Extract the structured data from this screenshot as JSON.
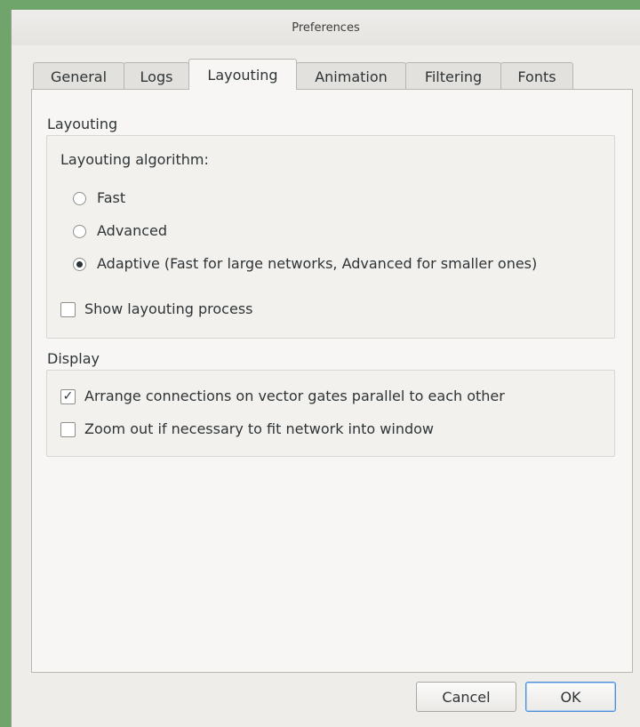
{
  "window": {
    "title": "Preferences"
  },
  "tabs": [
    {
      "label": "General"
    },
    {
      "label": "Logs"
    },
    {
      "label": "Layouting",
      "active": true
    },
    {
      "label": "Animation"
    },
    {
      "label": "Filtering"
    },
    {
      "label": "Fonts"
    }
  ],
  "layouting": {
    "section_title": "Layouting",
    "algorithm_label": "Layouting algorithm:",
    "options": [
      {
        "label": "Fast",
        "checked": false
      },
      {
        "label": "Advanced",
        "checked": false
      },
      {
        "label": "Adaptive (Fast for large networks, Advanced for smaller ones)",
        "checked": true
      }
    ],
    "show_process": {
      "label": "Show layouting process",
      "checked": false
    }
  },
  "display": {
    "section_title": "Display",
    "arrange_connections": {
      "label": "Arrange connections on vector gates parallel to each other",
      "checked": true,
      "mark": "✓"
    },
    "zoom_out": {
      "label": "Zoom out if necessary to fit network into window",
      "checked": false
    }
  },
  "buttons": {
    "cancel": "Cancel",
    "ok": "OK"
  }
}
